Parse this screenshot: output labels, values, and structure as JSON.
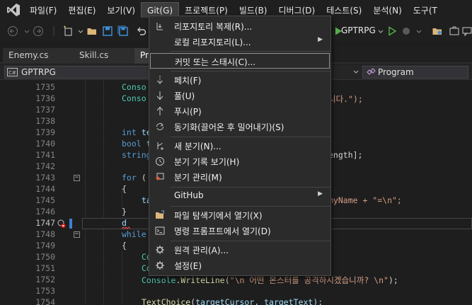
{
  "menubar": {
    "items": [
      "파일(F)",
      "편집(E)",
      "보기(V)",
      "Git(G)",
      "프로젝트(P)",
      "빌드(B)",
      "디버그(D)",
      "테스트(S)",
      "분석(N)",
      "도구(T"
    ],
    "active_index": 3
  },
  "toolbar": {
    "run_target": "GPTRPG"
  },
  "tabs": [
    "Enemy.cs",
    "Skill.cs",
    "Pro"
  ],
  "navbar": {
    "project": "GPTRPG",
    "member": "Program"
  },
  "git_menu": {
    "items": [
      {
        "label": "리포지토리 복제(R)...",
        "icon": "clone-icon",
        "submenu": false
      },
      {
        "label": "로컬 리포지토리(L)...",
        "icon": "",
        "submenu": true
      },
      {
        "label": "커밋 또는 스태시(C)...",
        "icon": "",
        "submenu": false
      },
      {
        "label": "페치(F)",
        "icon": "fetch-icon",
        "submenu": false
      },
      {
        "label": "풀(U)",
        "icon": "pull-icon",
        "submenu": false
      },
      {
        "label": "푸시(P)",
        "icon": "push-icon",
        "submenu": false
      },
      {
        "label": "동기화(끌어온 후 밀어내기)(S)",
        "icon": "sync-icon",
        "submenu": false
      },
      {
        "label": "새 분기(N)...",
        "icon": "new-branch-icon",
        "submenu": false
      },
      {
        "label": "분기 기록 보기(H)",
        "icon": "history-icon",
        "submenu": false
      },
      {
        "label": "분기 관리(M)",
        "icon": "manage-branches-icon",
        "submenu": false
      },
      {
        "label": "GitHub",
        "icon": "",
        "submenu": true
      },
      {
        "label": "파일 탐색기에서 열기(X)",
        "icon": "folder-open-icon",
        "submenu": false
      },
      {
        "label": "명령 프롬프트에서 열기(D)",
        "icon": "terminal-icon",
        "submenu": false
      },
      {
        "label": "원격 관리(A)...",
        "icon": "gear-icon",
        "submenu": false
      },
      {
        "label": "설정(E)",
        "icon": "gear-icon",
        "submenu": false
      }
    ]
  },
  "editor": {
    "current_line": "1747",
    "lines": [
      {
        "n": "1735",
        "code": "Conso"
      },
      {
        "n": "1736",
        "code": "Conso",
        "tail": "니다.\");"
      },
      {
        "n": "1737",
        "code": ""
      },
      {
        "n": "1738",
        "code": ""
      },
      {
        "n": "1739",
        "kw": "int",
        "code": " te"
      },
      {
        "n": "1740",
        "kw": "bool",
        "code": " t"
      },
      {
        "n": "1741",
        "kw": "string",
        "tail": "ength];"
      },
      {
        "n": "1742",
        "code": ""
      },
      {
        "n": "1743",
        "kw": "for",
        "code": " ("
      },
      {
        "n": "1744",
        "code": "{"
      },
      {
        "n": "1745",
        "code": "ta",
        "tail": "myName + \"=\\n\";"
      },
      {
        "n": "1746",
        "code": "}"
      },
      {
        "n": "1747",
        "code": "d"
      },
      {
        "n": "1748",
        "kw": "while"
      },
      {
        "n": "1749",
        "code": "{"
      },
      {
        "n": "1750",
        "code": "Co"
      },
      {
        "n": "1751",
        "code": "Co"
      },
      {
        "n": "1752",
        "cls": "Console",
        "mth": "WriteLine",
        "str": "\"\\n 어떤 몬스터를 공격하시겠습니까? \\n\"",
        "end": ");"
      },
      {
        "n": "1753",
        "code": ""
      },
      {
        "n": "1754",
        "mth": "TextChoice",
        "args": "targetCursor, targetText);"
      }
    ]
  }
}
